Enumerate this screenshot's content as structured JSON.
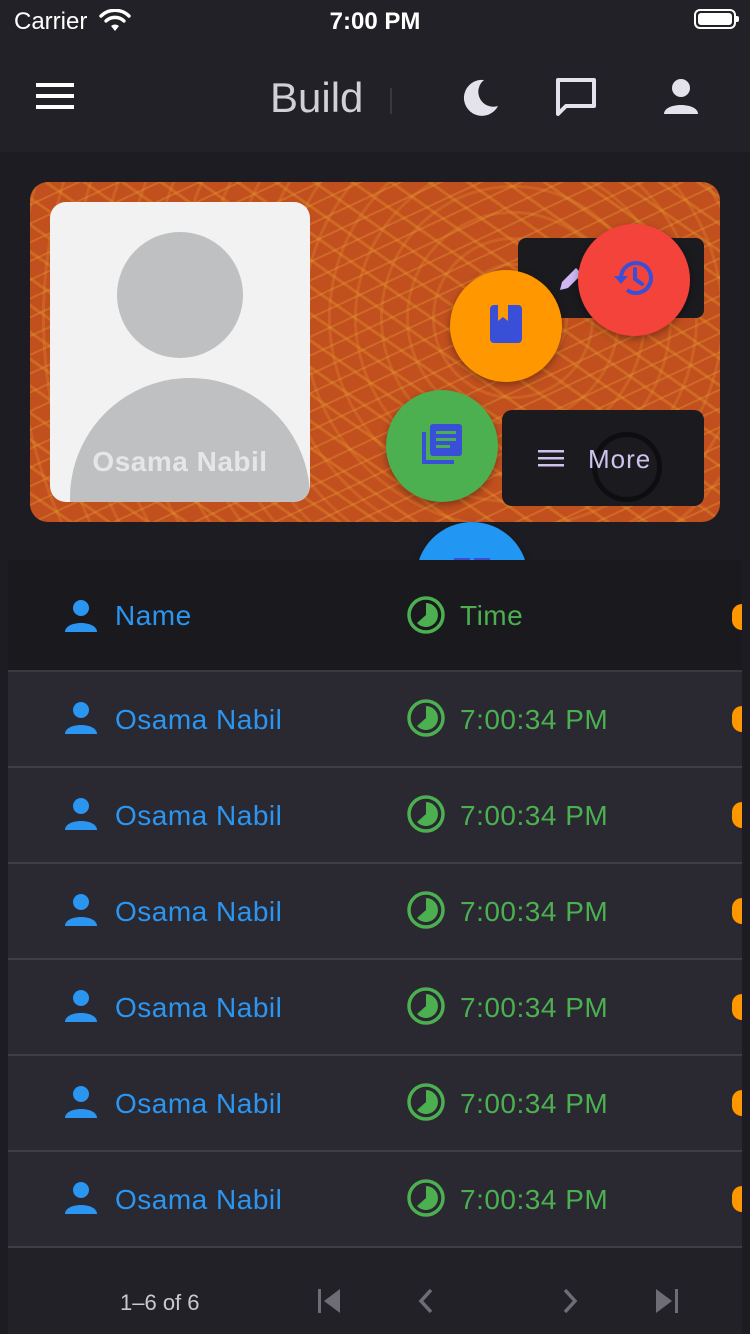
{
  "status_bar": {
    "carrier": "Carrier",
    "time": "7:00 PM"
  },
  "app_bar": {
    "title": "Build"
  },
  "profile": {
    "name": "Osama Nabil"
  },
  "actions": {
    "more_label": "More"
  },
  "table": {
    "headers": {
      "name": "Name",
      "time": "Time"
    },
    "rows": [
      {
        "name": "Osama Nabil",
        "time": "7:00:34 PM"
      },
      {
        "name": "Osama Nabil",
        "time": "7:00:34 PM"
      },
      {
        "name": "Osama Nabil",
        "time": "7:00:34 PM"
      },
      {
        "name": "Osama Nabil",
        "time": "7:00:34 PM"
      },
      {
        "name": "Osama Nabil",
        "time": "7:00:34 PM"
      },
      {
        "name": "Osama Nabil",
        "time": "7:00:34 PM"
      }
    ]
  },
  "pagination": {
    "range_label": "1–6 of 6"
  },
  "icons": {
    "menu": "menu-icon",
    "theme": "moon-icon",
    "chat": "chat-icon",
    "account": "person-icon",
    "edit": "pencil-icon",
    "history": "history-icon",
    "bookmark": "bookmark-icon",
    "notes": "library-books-icon",
    "dashboard": "dashboard-icon",
    "more": "menu-icon"
  },
  "colors": {
    "background": "#1d1c22",
    "appbar": "#222127",
    "card": "#c2501f",
    "name_blue": "#2b96f2",
    "time_green": "#4caf50",
    "accent_orange": "#ff9800",
    "fab_red": "#f4433a",
    "fab_blue": "#2196f3"
  }
}
